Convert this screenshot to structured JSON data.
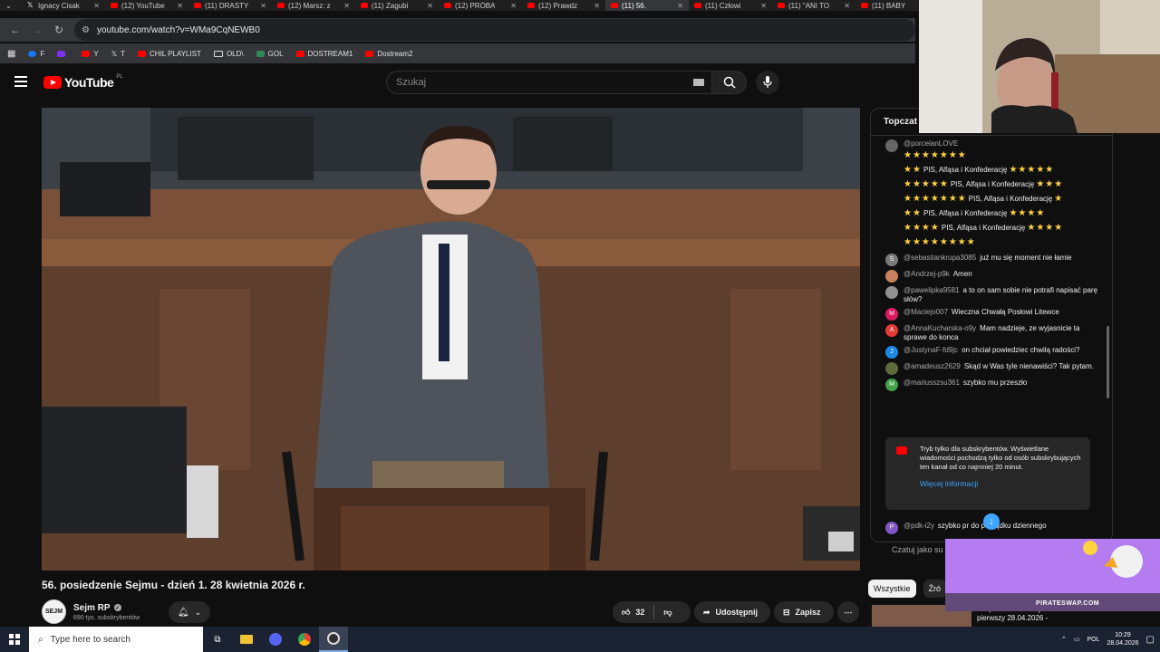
{
  "browser": {
    "tabs": [
      {
        "label": "Ignacy Cisak",
        "icon": "x-icon",
        "active": false
      },
      {
        "label": "(12) YouTube",
        "icon": "youtube-icon",
        "active": false
      },
      {
        "label": "(11) DRASTY",
        "icon": "youtube-icon",
        "active": false
      },
      {
        "label": "(12) Marsz: z",
        "icon": "youtube-icon",
        "active": false
      },
      {
        "label": "(11) Zagubi",
        "icon": "youtube-icon",
        "active": false
      },
      {
        "label": "(12) PRÓBA",
        "icon": "youtube-icon",
        "active": false
      },
      {
        "label": "(12) Prawdz",
        "icon": "youtube-icon",
        "active": false
      },
      {
        "label": "(11) 56.",
        "icon": "youtube-icon",
        "active": true
      },
      {
        "label": "(11) Człowi",
        "icon": "youtube-icon",
        "active": false
      },
      {
        "label": "(11) \"ANI TO",
        "icon": "youtube-icon",
        "active": false
      },
      {
        "label": "(11) BABY",
        "icon": "youtube-icon",
        "active": false
      }
    ],
    "url": "youtube.com/watch?v=WMa9CqNEWB0",
    "bookmarks": [
      {
        "label": "F",
        "icon": "facebook-icon"
      },
      {
        "label": "",
        "icon": "twitch-icon"
      },
      {
        "label": "Y",
        "icon": "youtube-icon"
      },
      {
        "label": "T",
        "icon": "x-icon"
      },
      {
        "label": "CHIL PLAYLIST",
        "icon": "youtube-icon"
      },
      {
        "label": "OLD\\",
        "icon": "folder-icon"
      },
      {
        "label": "GOL",
        "icon": "gol-icon"
      },
      {
        "label": "DOSTREAM1",
        "icon": "youtube-icon"
      },
      {
        "label": "Dostream2",
        "icon": "youtube-icon"
      }
    ]
  },
  "youtube": {
    "logo_text": "YouTube",
    "logo_region": "PL",
    "search_placeholder": "Szukaj"
  },
  "video": {
    "title": "56. posiedzenie Sejmu - dzień 1. 28 kwietnia 2026 r.",
    "channel": "Sejm RP",
    "channel_avatar_text": "SEJM",
    "subscribers": "690 tys. subskrybentów",
    "likes": "32",
    "share_label": "Udostępnij",
    "save_label": "Zapisz"
  },
  "chat": {
    "header": "Topczat",
    "messages": [
      {
        "user": "@porcelanLOVE",
        "text": "PIS, Alfąsa i Konfederację",
        "avatar_color": "#666666",
        "avatar_letter": "",
        "stars": true
      },
      {
        "user": "@sebastiankrupa3085",
        "text": "już mu się moment nie łamie",
        "avatar_color": "#7a7a7a",
        "avatar_letter": "S"
      },
      {
        "user": "@Andrzej-p9k",
        "text": "Amen",
        "avatar_color": "#c9805e",
        "avatar_letter": ""
      },
      {
        "user": "@pawelipka9581",
        "text": "a to on sam sobie nie potrafi napisać parę słów?",
        "avatar_color": "#909090",
        "avatar_letter": ""
      },
      {
        "user": "@Maciejo007",
        "text": "Wieczna Chwałą Posłowi Litewce",
        "avatar_color": "#d81b60",
        "avatar_letter": "M"
      },
      {
        "user": "@AnnaKucharska-o9y",
        "text": "Mam nadzieje, ze wyjasnicie ta sprawe do konca",
        "avatar_color": "#e53935",
        "avatar_letter": "A"
      },
      {
        "user": "@JustynaF-fd9jc",
        "text": "on chciał powiedziec chwilą radości?",
        "avatar_color": "#1e88e5",
        "avatar_letter": "J"
      },
      {
        "user": "@amadeusz2629",
        "text": "Skąd w Was tyle nienawiści? Tak pytam.",
        "avatar_color": "#5d6b3a",
        "avatar_letter": ""
      },
      {
        "user": "@mariusszsu361",
        "text": "szybko mu przeszło",
        "avatar_color": "#43a047",
        "avatar_letter": "M"
      }
    ],
    "notice": "Tryb tylko dla subskrybentów. Wyświetlane wiadomości pochodzą tylko od osób subskrybujących ten kanał od co najmniej 20 minut.",
    "notice_link": "Więcej informacji",
    "last_message": {
      "user": "@pdk-i2y",
      "text": "szybko pr do porządku dziennego",
      "avatar_color": "#7e57c2",
      "avatar_letter": "P"
    },
    "input_placeholder": "Czatuj jako su"
  },
  "chips": [
    "Wszystkie",
    "Źró"
  ],
  "recommendation": {
    "title": "56. posiedzenie Sejmu RP - dzień pierwszy 28.04.2026 -"
  },
  "ad": {
    "text": "PIRATESWAP.COM"
  },
  "taskbar": {
    "search_placeholder": "Type here to search",
    "language": "POL",
    "time": "10:29",
    "date": "28.04.2026"
  }
}
